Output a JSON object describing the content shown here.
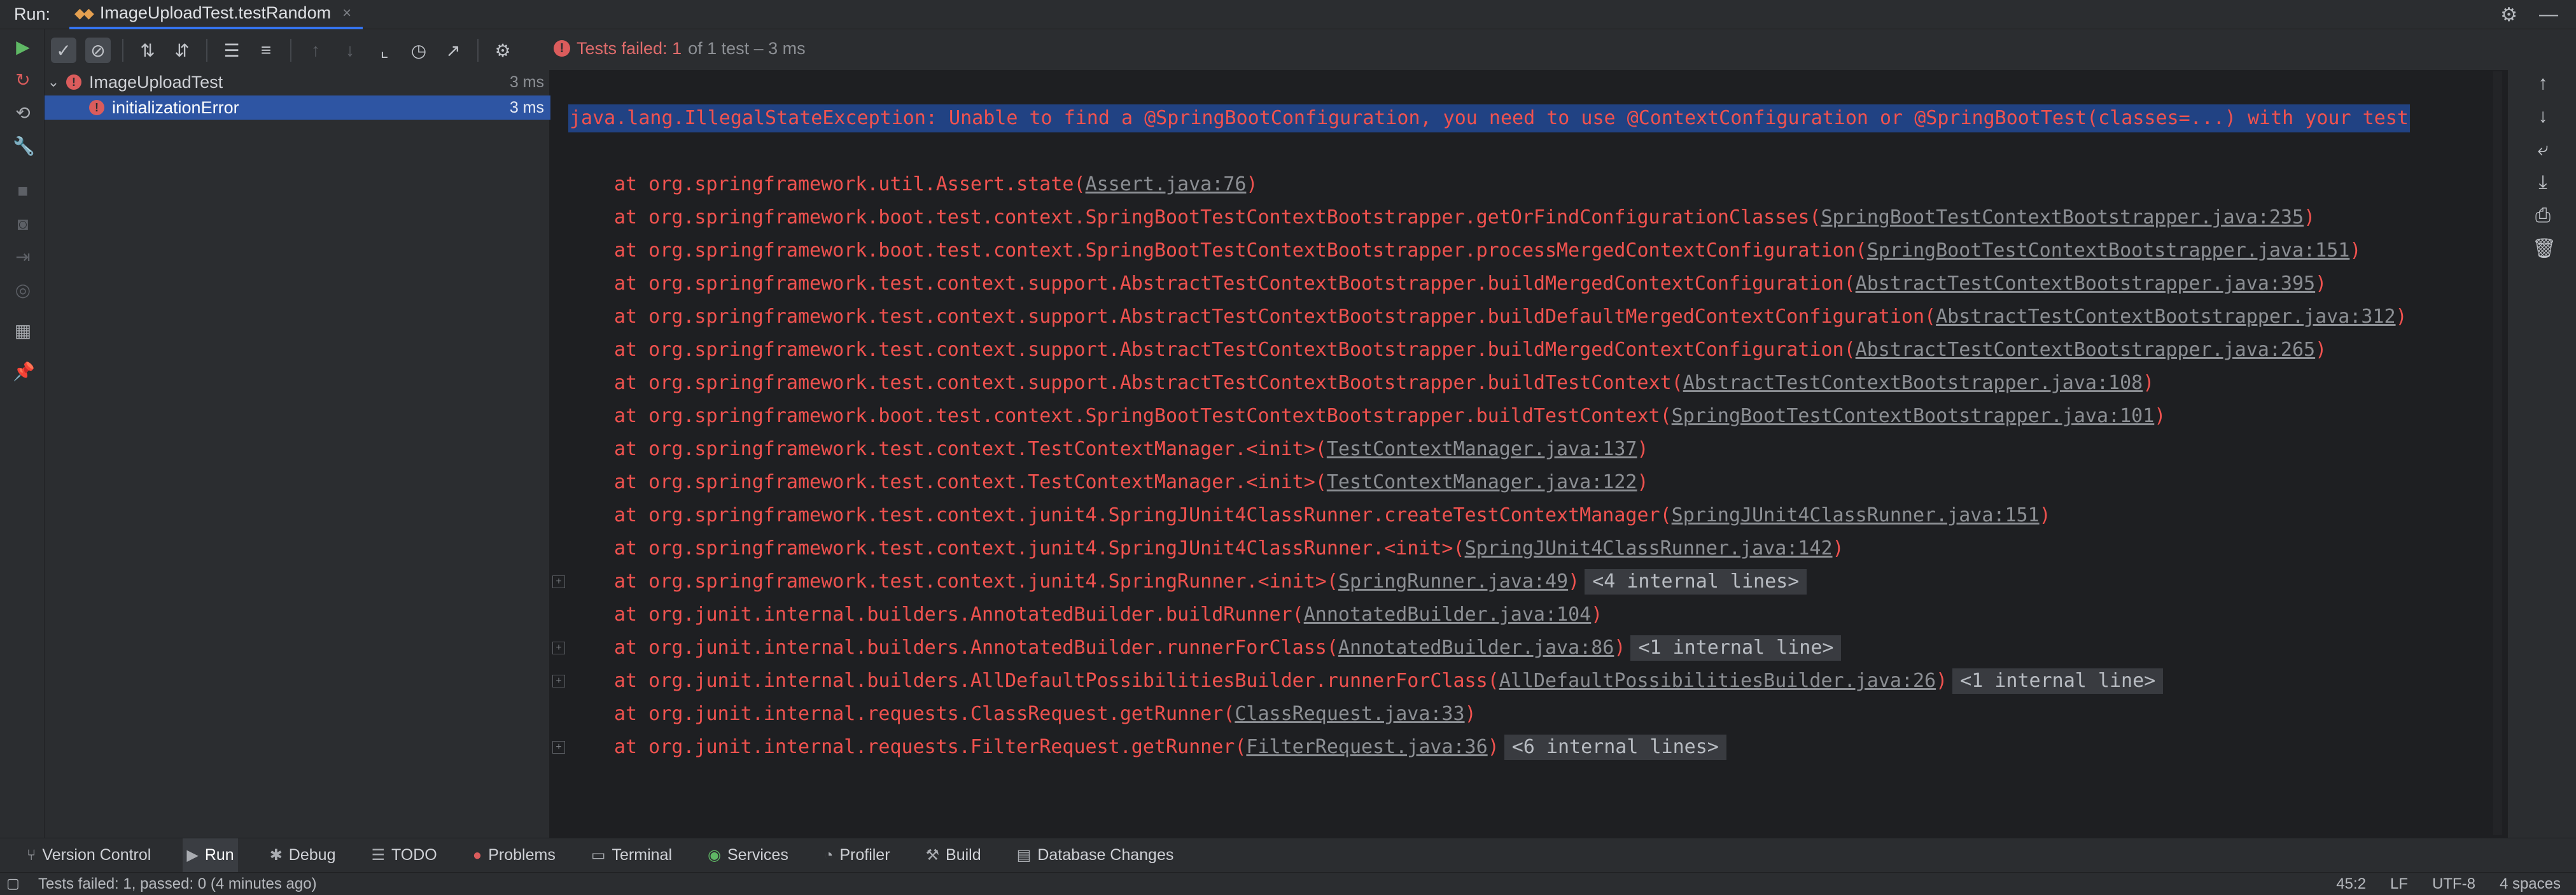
{
  "titlebar": {
    "run_label": "Run:",
    "tab_name": "ImageUploadTest.testRandom"
  },
  "status": {
    "failed_text": "Tests failed: 1",
    "rest_text": " of 1 test – 3 ms"
  },
  "tree": {
    "root": {
      "label": "ImageUploadTest",
      "time": "3 ms"
    },
    "child": {
      "label": "initializationError",
      "time": "3 ms"
    }
  },
  "console": {
    "exception": "java.lang.IllegalStateException: Unable to find a @SpringBootConfiguration, you need to use @ContextConfiguration or @SpringBootTest(classes=...) with your test",
    "frames": [
      {
        "method": "at org.springframework.util.Assert.state(",
        "link": "Assert.java:76",
        "internal": ""
      },
      {
        "method": "at org.springframework.boot.test.context.SpringBootTestContextBootstrapper.getOrFindConfigurationClasses(",
        "link": "SpringBootTestContextBootstrapper.java:235",
        "internal": ""
      },
      {
        "method": "at org.springframework.boot.test.context.SpringBootTestContextBootstrapper.processMergedContextConfiguration(",
        "link": "SpringBootTestContextBootstrapper.java:151",
        "internal": ""
      },
      {
        "method": "at org.springframework.test.context.support.AbstractTestContextBootstrapper.buildMergedContextConfiguration(",
        "link": "AbstractTestContextBootstrapper.java:395",
        "internal": ""
      },
      {
        "method": "at org.springframework.test.context.support.AbstractTestContextBootstrapper.buildDefaultMergedContextConfiguration(",
        "link": "AbstractTestContextBootstrapper.java:312",
        "internal": ""
      },
      {
        "method": "at org.springframework.test.context.support.AbstractTestContextBootstrapper.buildMergedContextConfiguration(",
        "link": "AbstractTestContextBootstrapper.java:265",
        "internal": ""
      },
      {
        "method": "at org.springframework.test.context.support.AbstractTestContextBootstrapper.buildTestContext(",
        "link": "AbstractTestContextBootstrapper.java:108",
        "internal": ""
      },
      {
        "method": "at org.springframework.boot.test.context.SpringBootTestContextBootstrapper.buildTestContext(",
        "link": "SpringBootTestContextBootstrapper.java:101",
        "internal": ""
      },
      {
        "method": "at org.springframework.test.context.TestContextManager.<init>(",
        "link": "TestContextManager.java:137",
        "internal": ""
      },
      {
        "method": "at org.springframework.test.context.TestContextManager.<init>(",
        "link": "TestContextManager.java:122",
        "internal": ""
      },
      {
        "method": "at org.springframework.test.context.junit4.SpringJUnit4ClassRunner.createTestContextManager(",
        "link": "SpringJUnit4ClassRunner.java:151",
        "internal": ""
      },
      {
        "method": "at org.springframework.test.context.junit4.SpringJUnit4ClassRunner.<init>(",
        "link": "SpringJUnit4ClassRunner.java:142",
        "internal": ""
      },
      {
        "method": "at org.springframework.test.context.junit4.SpringRunner.<init>(",
        "link": "SpringRunner.java:49",
        "internal": "<4 internal lines>"
      },
      {
        "method": "at org.junit.internal.builders.AnnotatedBuilder.buildRunner(",
        "link": "AnnotatedBuilder.java:104",
        "internal": ""
      },
      {
        "method": "at org.junit.internal.builders.AnnotatedBuilder.runnerForClass(",
        "link": "AnnotatedBuilder.java:86",
        "internal": "<1 internal line>"
      },
      {
        "method": "at org.junit.internal.builders.AllDefaultPossibilitiesBuilder.runnerForClass(",
        "link": "AllDefaultPossibilitiesBuilder.java:26",
        "internal": "<1 internal line>"
      },
      {
        "method": "at org.junit.internal.requests.ClassRequest.getRunner(",
        "link": "ClassRequest.java:33",
        "internal": ""
      },
      {
        "method": "at org.junit.internal.requests.FilterRequest.getRunner(",
        "link": "FilterRequest.java:36",
        "internal": "<6 internal lines>"
      }
    ]
  },
  "bottom_tabs": [
    {
      "label": "Version Control",
      "icon": "branch-icon"
    },
    {
      "label": "Run",
      "icon": "play-icon"
    },
    {
      "label": "Debug",
      "icon": "bug-icon"
    },
    {
      "label": "TODO",
      "icon": "list-icon"
    },
    {
      "label": "Problems",
      "icon": "problems-icon"
    },
    {
      "label": "Terminal",
      "icon": "terminal-icon"
    },
    {
      "label": "Services",
      "icon": "services-icon"
    },
    {
      "label": "Profiler",
      "icon": "profiler-icon"
    },
    {
      "label": "Build",
      "icon": "hammer-icon"
    },
    {
      "label": "Database Changes",
      "icon": "database-icon"
    }
  ],
  "statusbar": {
    "message": "Tests failed: 1, passed: 0 (4 minutes ago)",
    "position": "45:2",
    "line_sep": "LF",
    "encoding": "UTF-8",
    "indent": "4 spaces"
  },
  "colors": {
    "error": "#f0524f",
    "selection": "#2e55a3",
    "accent": "#3574f0"
  }
}
